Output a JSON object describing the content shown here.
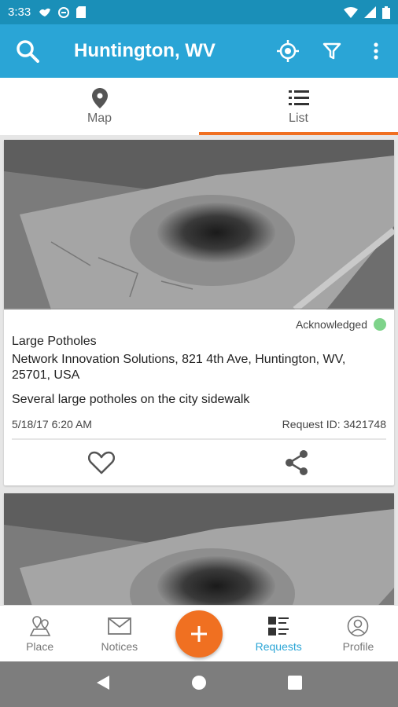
{
  "status_bar": {
    "time": "3:33"
  },
  "app_bar": {
    "title": "Huntington, WV"
  },
  "tabs": [
    {
      "label": "Map",
      "icon": "map-pin-icon",
      "active": false
    },
    {
      "label": "List",
      "icon": "list-icon",
      "active": true
    }
  ],
  "requests": [
    {
      "category": "Large Potholes",
      "address": "Network Innovation Solutions, 821 4th Ave, Huntington, WV, 25701, USA",
      "description": "Several large potholes on the city sidewalk",
      "date": "5/18/17 6:20 AM",
      "request_id": "Request ID: 3421748",
      "status": "Acknowledged",
      "status_color": "#7ed38a"
    }
  ],
  "bottom_nav": [
    {
      "label": "Place",
      "icon": "place-icon",
      "active": false
    },
    {
      "label": "Notices",
      "icon": "envelope-icon",
      "active": false
    },
    {
      "label": "Requests",
      "icon": "requests-icon",
      "active": true
    },
    {
      "label": "Profile",
      "icon": "profile-icon",
      "active": false
    }
  ],
  "colors": {
    "status_bar": "#1a8fb8",
    "app_bar": "#2aa5d6",
    "accent": "#f07021",
    "active_nav": "#2aa5d6"
  }
}
